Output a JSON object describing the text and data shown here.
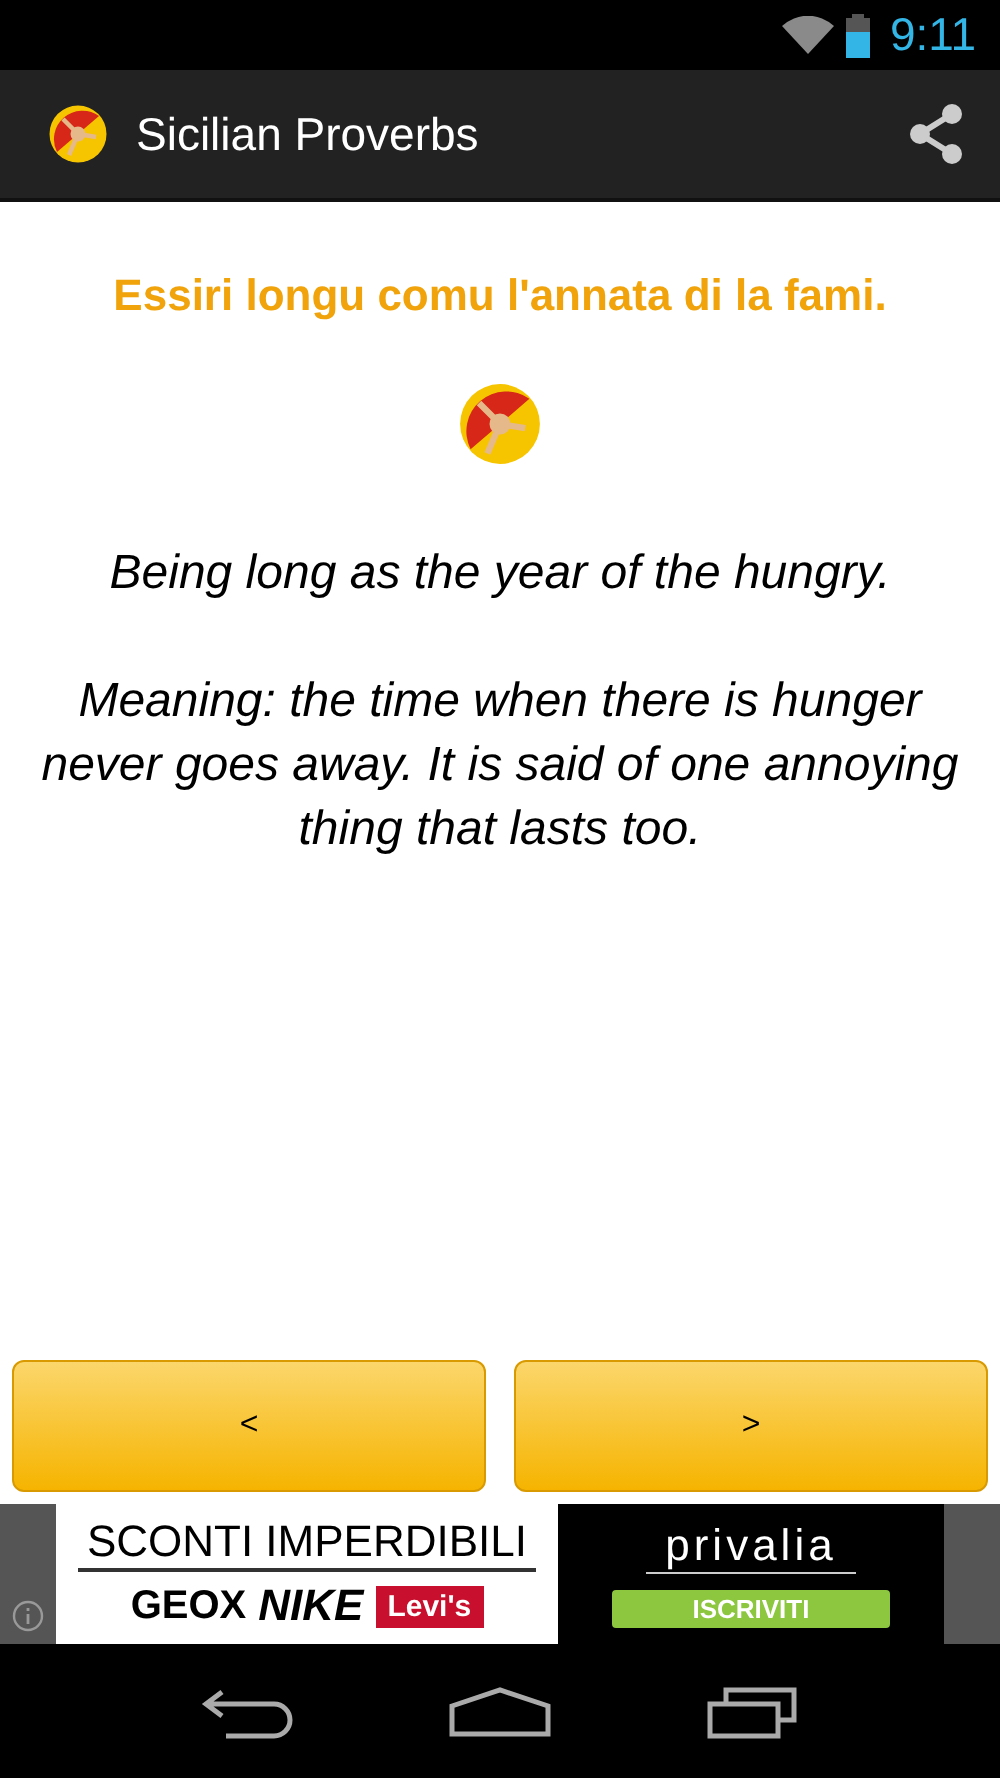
{
  "status_bar": {
    "time": "9:11"
  },
  "action_bar": {
    "title": "Sicilian Proverbs"
  },
  "proverb": {
    "sicilian": "Essiri longu comu l'annata di la fami.",
    "english": "Being long as the year of the hungry.",
    "meaning": "Meaning: the time when there is hunger never goes away. It is said of one annoying thing that lasts too."
  },
  "nav_buttons": [
    {
      "label": "<"
    },
    {
      "label": ">"
    }
  ],
  "ad": {
    "headline": "SCONTI IMPERDIBILI",
    "brands": [
      {
        "label": "GEOX",
        "kind": "plain"
      },
      {
        "label": "NIKE",
        "kind": "italic"
      },
      {
        "label": "Levi's",
        "kind": "tag"
      }
    ],
    "advertiser": "privalia",
    "cta": "ISCRIVITI"
  }
}
